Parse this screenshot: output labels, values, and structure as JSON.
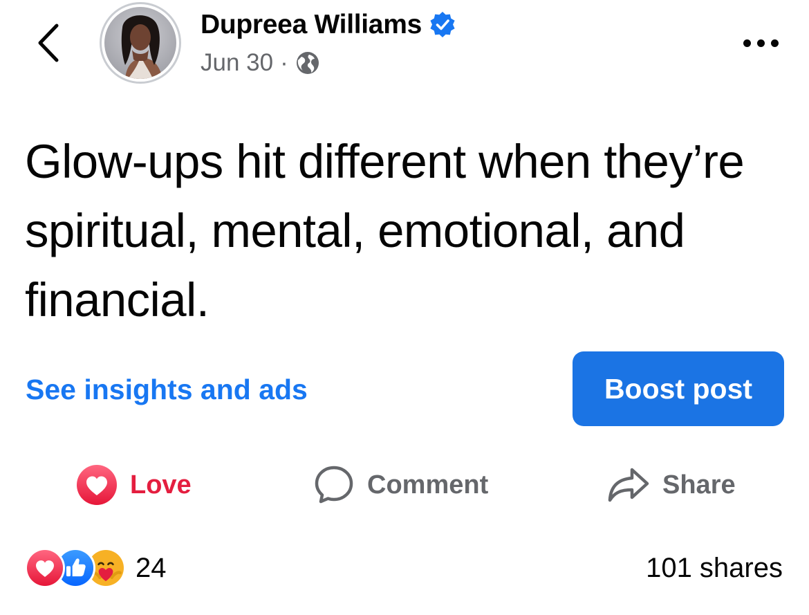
{
  "post": {
    "author": {
      "name": "Dupreea Williams",
      "verified_icon": "verified-badge-icon",
      "avatar_icon": "profile-photo"
    },
    "date": "Jun 30",
    "separator": "·",
    "audience_icon": "globe-icon",
    "text": "Glow-ups hit different when they’re spiritual, mental, emotional, and financial.",
    "insights_label": "See insights and ads",
    "boost_label": "Boost post"
  },
  "actions": {
    "love_label": "Love",
    "comment_label": "Comment",
    "share_label": "Share"
  },
  "summary": {
    "reaction_icons": [
      "love-reaction-icon",
      "like-reaction-icon",
      "care-reaction-icon"
    ],
    "reaction_count": "24",
    "shares_label": "101 shares"
  },
  "colors": {
    "facebook_blue": "#1877f2",
    "boost_blue": "#1b74e4",
    "love_red": "#e41e3f",
    "secondary_text": "#65676b",
    "primary_text": "#050505"
  }
}
